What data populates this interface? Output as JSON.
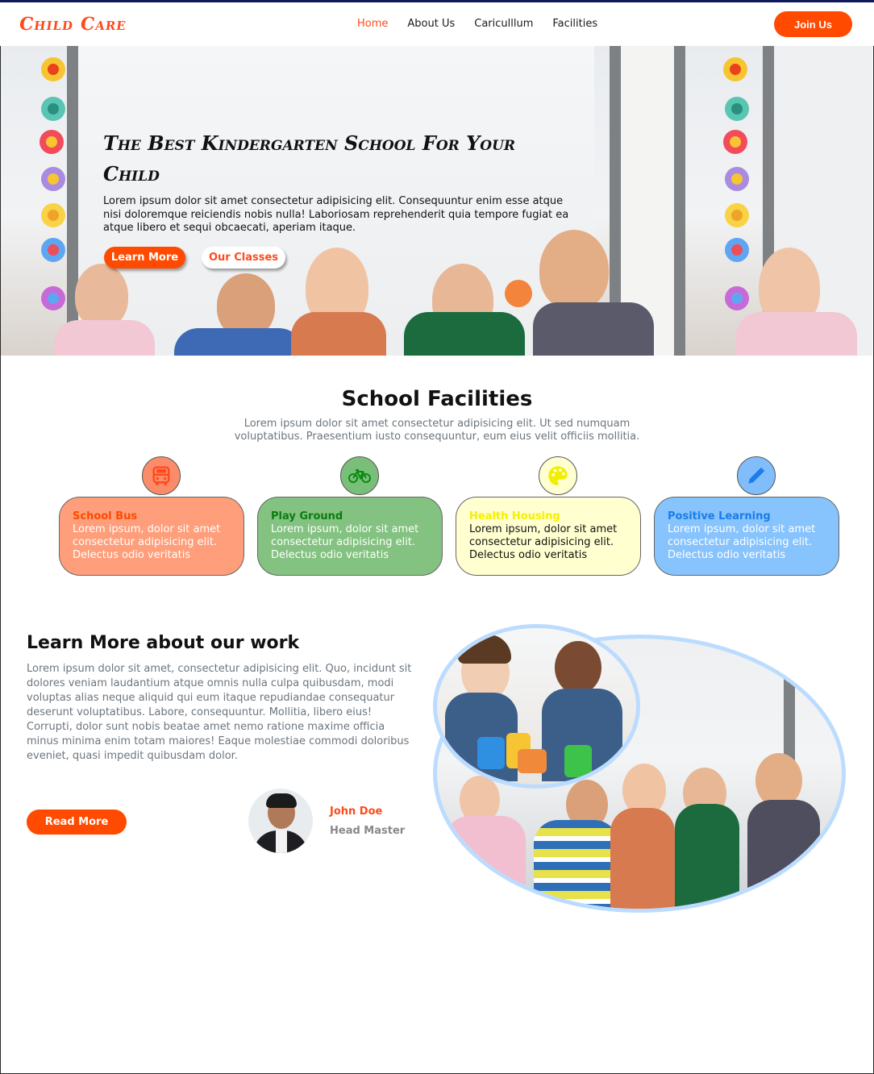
{
  "nav": {
    "logo": "Child Care",
    "links": [
      "Home",
      "About Us",
      "Cariculllum",
      "Facilities"
    ],
    "active_link": "Home",
    "join_label": "Join Us"
  },
  "hero": {
    "title": "The Best Kindergarten School For Your Child",
    "text": "Lorem ipsum dolor sit amet consectetur adipisicing elit. Consequuntur enim esse atque nisi doloremque reiciendis nobis nulla! Laboriosam reprehenderit quia tempore fugiat ea atque libero et sequi obcaecati, aperiam itaque.",
    "learn_more_label": "Learn More",
    "classes_label": "Our Classes"
  },
  "facilities": {
    "title": "School Facilities",
    "subtitle": "Lorem ipsum dolor sit amet consectetur adipisicing elit. Ut sed numquam voluptatibus. Praesentium iusto consequuntur, eum eius velit officiis mollitia.",
    "cards": [
      {
        "title": "School Bus",
        "text": "Lorem ipsum, dolor sit amet consectetur adipisicing elit. Delectus odio veritatis",
        "icon": "bus-icon",
        "bg": "#fe9e7a",
        "title_color": "#ff4a00",
        "text_color": "#ffffff",
        "icon_bg": "#fb8c6a",
        "icon_color": "#ff4a1c"
      },
      {
        "title": "Play Ground",
        "text": "Lorem ipsum, dolor sit amet consectetur adipisicing elit. Delectus odio veritatis",
        "icon": "bicycle-icon",
        "bg": "#83c280",
        "title_color": "#0a7d10",
        "text_color": "#ffffff",
        "icon_bg": "#7abf79",
        "icon_color": "#0b8a11"
      },
      {
        "title": "Health Housing",
        "text": "Lorem ipsum, dolor sit amet consectetur adipisicing elit. Delectus odio veritatis",
        "icon": "palette-icon",
        "bg": "#ffffd0",
        "title_color": "#f5f000",
        "text_color": "#111111",
        "icon_bg": "#ffffd0",
        "icon_color": "#f2ee00"
      },
      {
        "title": "Positive Learning",
        "text": "Lorem ipsum, dolor sit amet consectetur adipisicing elit. Delectus odio veritatis",
        "icon": "pencil-icon",
        "bg": "#87c3fd",
        "title_color": "#1a7de8",
        "text_color": "#ffffff",
        "icon_bg": "#82bdfb",
        "icon_color": "#1a7de8"
      }
    ]
  },
  "learn": {
    "title": "Learn More about our work",
    "text": "Lorem ipsum dolor sit amet, consectetur adipisicing elit. Quo, incidunt sit dolores veniam laudantium atque omnis nulla culpa quibusdam, modi voluptas alias neque aliquid qui eum itaque repudiandae consequatur deserunt voluptatibus. Labore, consequuntur. Mollitia, libero eius! Corrupti, dolor sunt nobis beatae amet nemo ratione maxime officia minus minima enim totam maiores! Eaque molestiae commodi doloribus eveniet, quasi impedit quibusdam dolor.",
    "read_more_label": "Read More",
    "person_name": "John Doe",
    "person_role": "Head Master"
  },
  "colors": {
    "accent": "#ff4a00",
    "oval_border": "#bcdcff"
  }
}
